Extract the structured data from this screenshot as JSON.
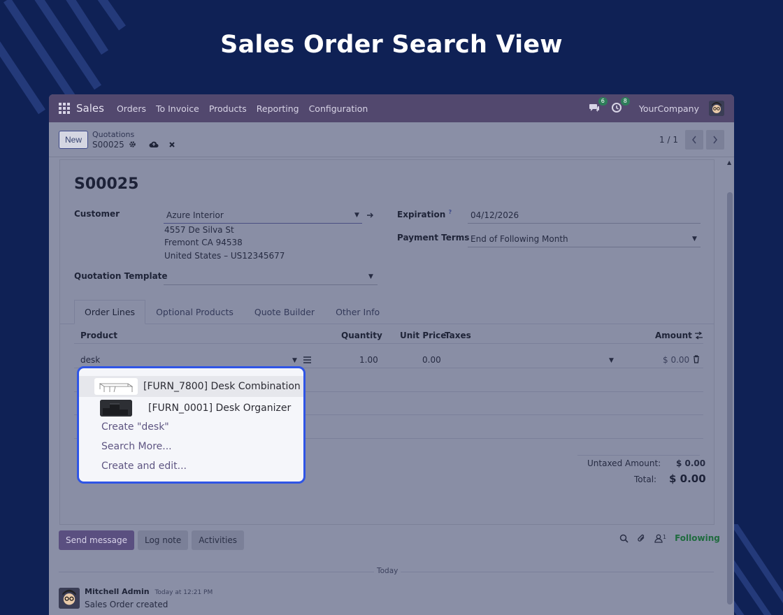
{
  "hero": {
    "title": "Sales Order Search View"
  },
  "topbar": {
    "app_name": "Sales",
    "nav": [
      "Orders",
      "To Invoice",
      "Products",
      "Reporting",
      "Configuration"
    ],
    "messages_count": "6",
    "activities_count": "8",
    "company": "YourCompany"
  },
  "control": {
    "new_label": "New",
    "breadcrumb_parent": "Quotations",
    "breadcrumb_record": "S00025",
    "pager": "1 / 1"
  },
  "form": {
    "title": "S00025",
    "customer_label": "Customer",
    "customer_value": "Azure Interior",
    "address_line1": "4557 De Silva St",
    "address_line2": "Fremont CA 94538",
    "address_line3": "United States – US12345677",
    "expiration_label": "Expiration",
    "expiration_help": "?",
    "expiration_value": "04/12/2026",
    "payment_terms_label": "Payment Terms",
    "payment_terms_value": "End of Following Month",
    "quotation_template_label": "Quotation Template",
    "quotation_template_value": ""
  },
  "tabs": [
    "Order Lines",
    "Optional Products",
    "Quote Builder",
    "Other Info"
  ],
  "order_lines": {
    "headers": {
      "product": "Product",
      "quantity": "Quantity",
      "unit_price": "Unit Price",
      "taxes": "Taxes",
      "amount": "Amount"
    },
    "row": {
      "product": "desk",
      "quantity": "1.00",
      "unit_price": "0.00",
      "amount": "$ 0.00"
    }
  },
  "totals": {
    "untaxed_label": "Untaxed Amount:",
    "untaxed_value": "$ 0.00",
    "total_label": "Total:",
    "total_value": "$ 0.00"
  },
  "dropdown": {
    "items": [
      {
        "label": "[FURN_7800] Desk Combination"
      },
      {
        "label": "[FURN_0001] Desk Organizer"
      }
    ],
    "create_label": "Create \"desk\"",
    "search_more_label": "Search More...",
    "create_edit_label": "Create and edit..."
  },
  "chatter": {
    "send_message": "Send message",
    "log_note": "Log note",
    "activities": "Activities",
    "followers_count": "1",
    "following": "Following",
    "today": "Today",
    "author": "Mitchell Admin",
    "time": "Today at 12:21 PM",
    "message": "Sales Order created"
  },
  "colors": {
    "background": "#0f2155",
    "navbar": "#52486e",
    "dropdown_border": "#2f55e6",
    "following": "#1f6b3e"
  }
}
